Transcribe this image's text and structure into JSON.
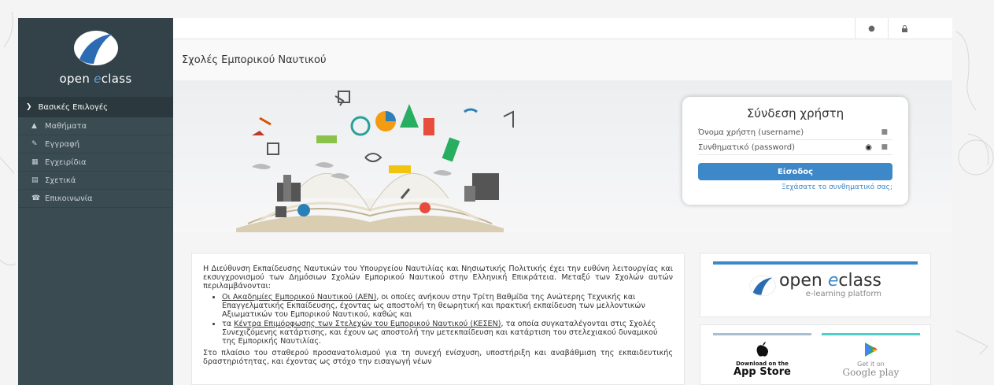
{
  "sidebar": {
    "logo_text_prefix": "open ",
    "logo_text_e": "e",
    "logo_text_suffix": "class",
    "section_title": "Βασικές Επιλογές",
    "items": [
      {
        "label": "Μαθήματα",
        "icon": "graduation-cap-icon"
      },
      {
        "label": "Εγγραφή",
        "icon": "edit-icon"
      },
      {
        "label": "Εγχειρίδια",
        "icon": "file-icon"
      },
      {
        "label": "Σχετικά",
        "icon": "credit-card-icon"
      },
      {
        "label": "Επικοινωνία",
        "icon": "phone-icon"
      }
    ]
  },
  "topbar": {
    "icons": [
      "question-icon",
      "lock-icon"
    ]
  },
  "page_title": "Σχολές Εμπορικού Ναυτικού",
  "login": {
    "title": "Σύνδεση χρήστη",
    "username_placeholder": "Όνομα χρήστη (username)",
    "password_placeholder": "Συνθηματικό (password)",
    "submit_label": "Είσοδος",
    "forgot_label": "Ξεχάσατε το συνθηματικό σας;"
  },
  "info": {
    "intro": "Η Διεύθυνση Εκπαίδευσης Ναυτικών του Υπουργείου Ναυτιλίας και Νησιωτικής Πολιτικής έχει την ευθύνη λειτουργίας και εκσυγχρονισμού των Δημόσιων Σχολών Εμπορικού Ναυτικού στην Ελληνική Επικράτεια. Μεταξύ των Σχολών αυτών περιλαμβάνονται:",
    "bullet1_link": "Οι Ακαδημίες Εμπορικού Ναυτικού (ΑΕΝ)",
    "bullet1_text": ", οι οποίες ανήκουν στην Τρίτη Βαθμίδα της Ανώτερης Τεχνικής και Επαγγελματικής Εκπαίδευσης, έχοντας ως αποστολή τη θεωρητική και πρακτική εκπαίδευση των μελλοντικών Αξιωματικών του Εμπορικού Ναυτικού, καθώς και",
    "bullet2_prefix": "τα ",
    "bullet2_link": "Κέντρα Επιμόρφωσης των Στελεχών του Εμπορικού Ναυτικού (ΚΕΣΕΝ)",
    "bullet2_text": ", τα οποία συγκαταλέγονται στις Σχολές Συνεχιζόμενης κατάρτισης, και έχουν ως αποστολή την μετεκπαίδευση και κατάρτιση του στελεχιακού δυναμικού της Εμπορικής Ναυτιλίας.",
    "para2": "Στο πλαίσιο του σταθερού προσανατολισμού για τη συνεχή ενίσχυση, υποστήριξη και αναβάθμιση της εκπαιδευτικής δραστηριότητας, και έχοντας ως στόχο την εισαγωγή νέων"
  },
  "promo": {
    "brand_prefix": "open ",
    "brand_e": "e",
    "brand_suffix": "class",
    "tagline": "e-learning platform",
    "appstore_small": "Download on the",
    "appstore_big": "App Store",
    "gplay_small": "Get it on",
    "gplay_big": "Google play"
  },
  "colors": {
    "sidebar": "#3b4b52",
    "accent": "#3d88c8"
  }
}
